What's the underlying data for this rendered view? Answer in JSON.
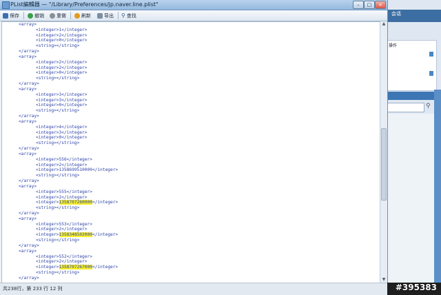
{
  "window": {
    "title": "PList編輯器 — \"/Library/Preferences/jp.naver.line.plist\""
  },
  "toolbar": {
    "save": "保存",
    "undo": "撤销",
    "redo": "重做",
    "refresh": "刷新",
    "export": "导出",
    "find": "查找"
  },
  "code_lines": [
    {
      "text": "<array>",
      "indent": 1
    },
    {
      "text": "<integer>1</integer>",
      "indent": 2
    },
    {
      "text": "<integer>2</integer>",
      "indent": 2
    },
    {
      "text": "<integer>0</integer>",
      "indent": 2
    },
    {
      "text": "<string></string>",
      "indent": 2
    },
    {
      "text": "</array>",
      "indent": 1
    },
    {
      "text": "<array>",
      "indent": 1
    },
    {
      "text": "<integer>2</integer>",
      "indent": 2
    },
    {
      "text": "<integer>2</integer>",
      "indent": 2
    },
    {
      "text": "<integer>0</integer>",
      "indent": 2
    },
    {
      "text": "<string></string>",
      "indent": 2
    },
    {
      "text": "</array>",
      "indent": 1
    },
    {
      "text": "<array>",
      "indent": 1
    },
    {
      "text": "<integer>3</integer>",
      "indent": 2
    },
    {
      "text": "<integer>3</integer>",
      "indent": 2
    },
    {
      "text": "<integer>0</integer>",
      "indent": 2
    },
    {
      "text": "<string></string>",
      "indent": 2
    },
    {
      "text": "</array>",
      "indent": 1
    },
    {
      "text": "<array>",
      "indent": 1
    },
    {
      "text": "<integer>4</integer>",
      "indent": 2
    },
    {
      "text": "<integer>3</integer>",
      "indent": 2
    },
    {
      "text": "<integer>0</integer>",
      "indent": 2
    },
    {
      "text": "<string></string>",
      "indent": 2
    },
    {
      "text": "</array>",
      "indent": 1
    },
    {
      "text": "<array>",
      "indent": 1
    },
    {
      "text": "<integer>556</integer>",
      "indent": 2
    },
    {
      "text": "<integer>2</integer>",
      "indent": 2
    },
    {
      "text": "<integer>1358699510000</integer>",
      "indent": 2
    },
    {
      "text": "<string></string>",
      "indent": 2
    },
    {
      "text": "</array>",
      "indent": 1
    },
    {
      "text": "<array>",
      "indent": 1
    },
    {
      "text": "<integer>555</integer>",
      "indent": 2
    },
    {
      "text": "<integer>2</integer>",
      "indent": 2
    },
    {
      "text": "<integer>1358707260000</integer>",
      "indent": 2,
      "hl": "1358707260000"
    },
    {
      "text": "<string></string>",
      "indent": 2
    },
    {
      "text": "</array>",
      "indent": 1
    },
    {
      "text": "<array>",
      "indent": 1
    },
    {
      "text": "<integer>553</integer>",
      "indent": 2
    },
    {
      "text": "<integer>2</integer>",
      "indent": 2
    },
    {
      "text": "<integer>1358348502000</integer>",
      "indent": 2,
      "hl": "1358348502000"
    },
    {
      "text": "<string></string>",
      "indent": 2
    },
    {
      "text": "</array>",
      "indent": 1
    },
    {
      "text": "<array>",
      "indent": 1
    },
    {
      "text": "<integer>552</integer>",
      "indent": 2
    },
    {
      "text": "<integer>2</integer>",
      "indent": 2
    },
    {
      "text": "<integer>1358707267000</integer>",
      "indent": 2,
      "hl": "1358707267000"
    },
    {
      "text": "<string></string>",
      "indent": 2
    },
    {
      "text": "</array>",
      "indent": 1
    }
  ],
  "status": "共238行，第 233 行 12 列",
  "background_window": {
    "title": "会话",
    "panel_label": "操作"
  },
  "watermark": "#395383",
  "colors": {
    "highlight": "#f7ef2b",
    "code_text": "#2f45a8",
    "titlebar": "#a9c8ea"
  }
}
